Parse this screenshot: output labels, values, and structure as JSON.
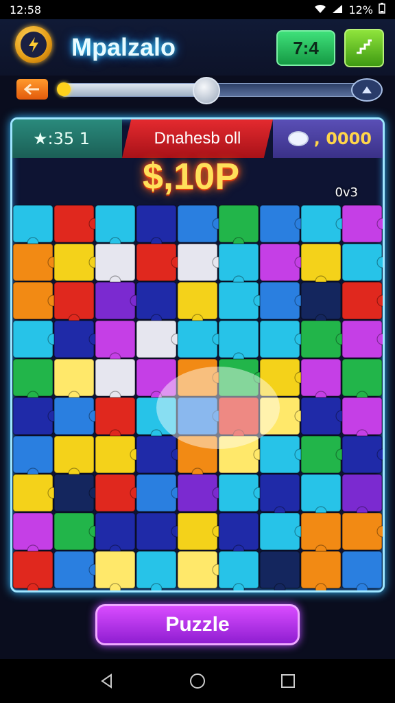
{
  "status": {
    "time": "12:58",
    "battery": "12%"
  },
  "header": {
    "title": "Mpalzalo",
    "level": "7:4"
  },
  "progress": {
    "value": 0.46
  },
  "board": {
    "stars": "★:35  1",
    "banner": "Dnahesb oll",
    "coins": ", 0000",
    "score": "$,10P",
    "moves": "0v3"
  },
  "action": {
    "label": "Puzzle"
  },
  "icons": [
    "lightning-icon",
    "music-icon",
    "back-arrow-icon",
    "end-flag-icon",
    "coin-icon",
    "wifi-icon",
    "signal-icon",
    "battery-icon",
    "back-nav-icon",
    "home-nav-icon",
    "recents-nav-icon"
  ],
  "colors": {
    "accent": "#3fd9ff",
    "button": "#b64cff",
    "score": "#ffe05a"
  }
}
